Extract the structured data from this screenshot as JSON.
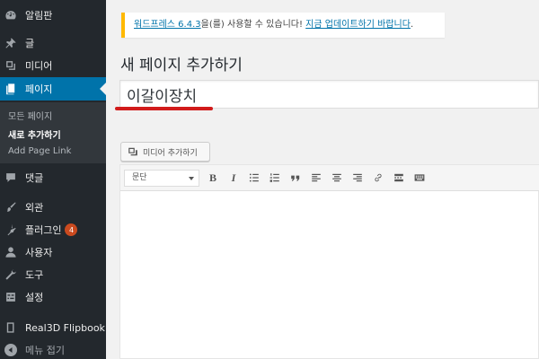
{
  "sidebar": {
    "items": [
      {
        "label": "알림판",
        "icon": "dashboard-icon"
      },
      {
        "label": "글",
        "icon": "pin-icon"
      },
      {
        "label": "미디어",
        "icon": "media-icon"
      },
      {
        "label": "페이지",
        "icon": "page-icon",
        "active": true
      },
      {
        "label": "댓글",
        "icon": "comment-icon"
      },
      {
        "label": "외관",
        "icon": "brush-icon"
      },
      {
        "label": "플러그인",
        "icon": "plugin-icon",
        "badge": "4"
      },
      {
        "label": "사용자",
        "icon": "user-icon"
      },
      {
        "label": "도구",
        "icon": "wrench-icon"
      },
      {
        "label": "설정",
        "icon": "settings-icon"
      },
      {
        "label": "Real3D Flipbook",
        "icon": "book-icon"
      }
    ],
    "submenu": [
      {
        "label": "모든 페이지"
      },
      {
        "label": "새로 추가하기",
        "current": true
      },
      {
        "label": "Add Page Link"
      }
    ],
    "collapse_label": "메뉴 접기"
  },
  "notice": {
    "link1": "워드프레스 6.4.3",
    "text": "을(를) 사용할 수 있습니다!",
    "link2": "지금 업데이트하기 바랍니다",
    "end": "."
  },
  "page_title": "새 페이지 추가하기",
  "title_input": {
    "value": "이갈이장치"
  },
  "media_button": {
    "label": "미디어 추가하기"
  },
  "editor": {
    "format_select": {
      "value": "문단"
    },
    "toolbar_buttons": [
      "bold",
      "italic",
      "bullet-list",
      "numbered-list",
      "blockquote",
      "align-left",
      "align-center",
      "align-right",
      "link",
      "read-more",
      "toolbar-toggle"
    ],
    "bold_label": "B",
    "italic_label": "I"
  },
  "colors": {
    "sidebar_bg": "#23282d",
    "active_bg": "#0073aa",
    "notice_border": "#ffb900",
    "badge": "#ca4a1f",
    "underline": "#d11b1b"
  }
}
